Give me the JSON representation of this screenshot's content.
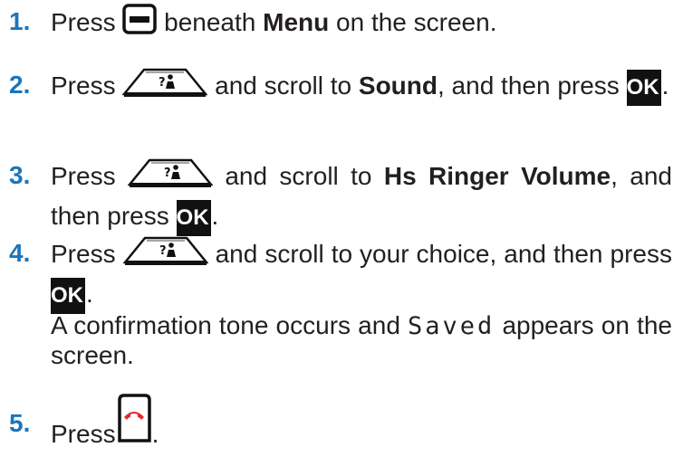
{
  "steps": [
    {
      "number": "1.",
      "t1": "Press",
      "t2": "beneath",
      "bold": "Menu",
      "t3": "on the screen.",
      "icon": "menu-softkey-icon"
    },
    {
      "number": "2.",
      "t1": "Press",
      "t2": "and scroll to",
      "bold": "Sound",
      "t3": ", and then press",
      "ok": "OK",
      "end": ".",
      "icon": "navigation-key-icon"
    },
    {
      "number": "3.",
      "t1": "Press",
      "t2": "and scroll to",
      "bold": "Hs Ringer Volume",
      "t3": ", and then press",
      "ok": "OK",
      "end": ".",
      "icon": "navigation-key-icon"
    },
    {
      "number": "4.",
      "t1": "Press",
      "t2": "and scroll to your choice, and then press",
      "ok": "OK",
      "end": ".",
      "icon": "navigation-key-icon"
    },
    {
      "number": "5.",
      "t1": "Press",
      "end": ".",
      "icon": "end-call-icon"
    }
  ],
  "note": {
    "before": "A confirmation tone occurs and",
    "screen_text": "Saved",
    "after": "appears on the screen."
  },
  "colors": {
    "step_number": "#1b75bb",
    "end_call": "#e8262a",
    "text": "#231f20"
  }
}
